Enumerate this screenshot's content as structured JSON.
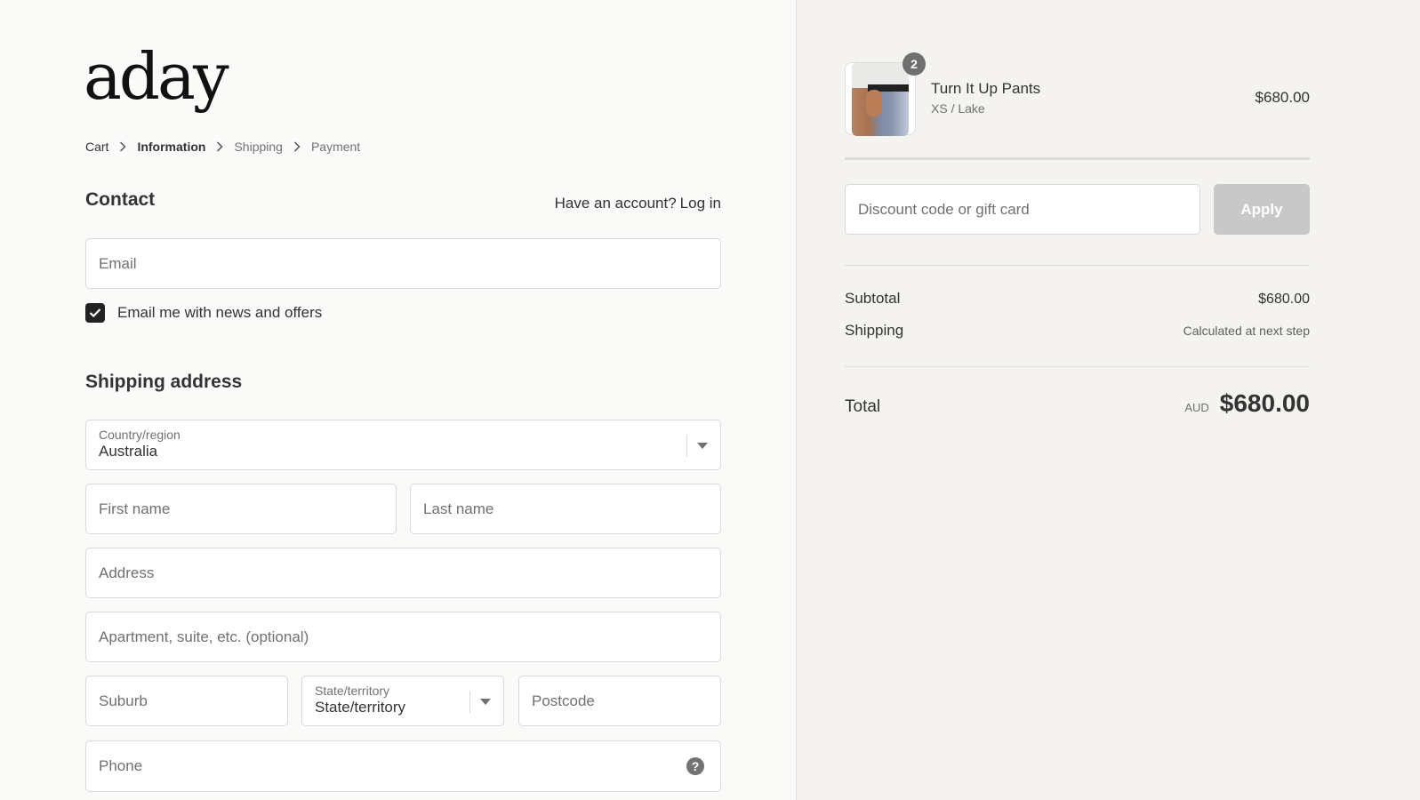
{
  "brand": {
    "logo_text": "aday"
  },
  "breadcrumb": [
    {
      "label": "Cart",
      "state": "link"
    },
    {
      "label": "Information",
      "state": "current"
    },
    {
      "label": "Shipping",
      "state": "upcoming"
    },
    {
      "label": "Payment",
      "state": "upcoming"
    }
  ],
  "contact": {
    "title": "Contact",
    "account_prompt": "Have an account?",
    "login_label": "Log in",
    "email_placeholder": "Email",
    "newsletter_label": "Email me with news and offers",
    "newsletter_checked": true
  },
  "shipping": {
    "title": "Shipping address",
    "country_label": "Country/region",
    "country_value": "Australia",
    "first_name_placeholder": "First name",
    "last_name_placeholder": "Last name",
    "address_placeholder": "Address",
    "apartment_placeholder": "Apartment, suite, etc. (optional)",
    "suburb_placeholder": "Suburb",
    "state_label": "State/territory",
    "state_value": "State/territory",
    "postcode_placeholder": "Postcode",
    "phone_placeholder": "Phone"
  },
  "order": {
    "item": {
      "name": "Turn It Up Pants",
      "variant": "XS / Lake",
      "price": "$680.00",
      "quantity": "2"
    },
    "discount_placeholder": "Discount code or gift card",
    "apply_label": "Apply",
    "subtotal_label": "Subtotal",
    "subtotal_value": "$680.00",
    "shipping_label": "Shipping",
    "shipping_value": "Calculated at next step",
    "total_label": "Total",
    "currency": "AUD",
    "total_value": "$680.00"
  },
  "colors": {
    "left_bg": "#fafaf9",
    "right_bg": "#f4f3ef",
    "checkbox": "#222222",
    "apply_disabled": "#c8c8c8"
  }
}
